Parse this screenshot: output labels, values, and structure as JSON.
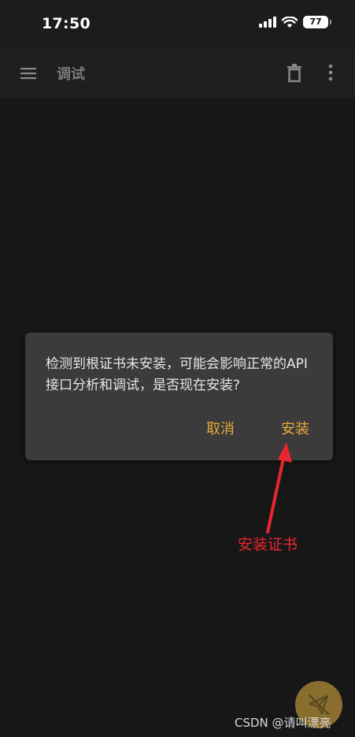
{
  "status_bar": {
    "time": "17:50",
    "battery_level": "77"
  },
  "app_bar": {
    "title": "调试"
  },
  "dialog": {
    "message": "检测到根证书未安装，可能会影响正常的API接口分析和调试，是否现在安装?",
    "cancel_label": "取消",
    "install_label": "安装"
  },
  "annotation": {
    "text": "安装证书"
  },
  "watermark": {
    "text": "CSDN @请叫漂亮"
  },
  "colors": {
    "accent": "#e8a93a",
    "annotation": "#e8262e",
    "dialog_bg": "#3b3b3b",
    "fab_bg": "#8a6e2f"
  }
}
